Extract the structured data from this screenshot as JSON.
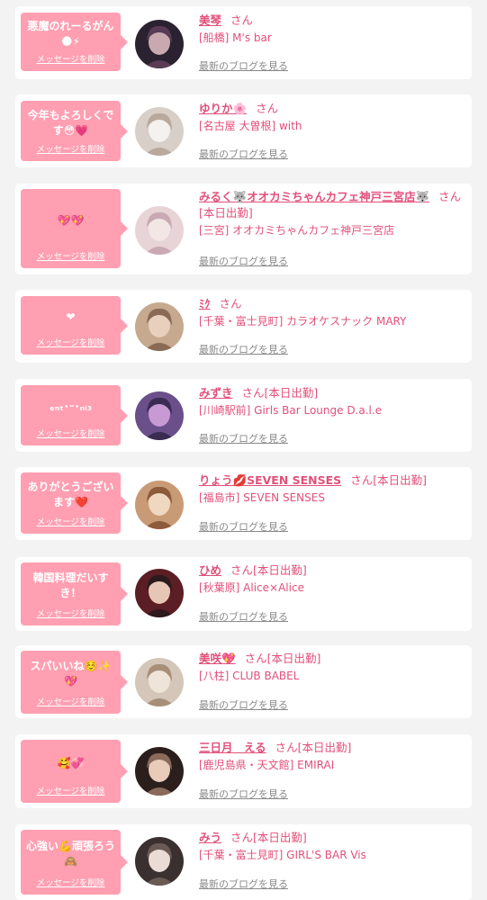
{
  "delete_label": "メッセージを削除",
  "blog_label": "最新のブログを見る",
  "colors": {
    "accent": "#e2507a",
    "bubble": "#ff9fb1",
    "background": "#f3f3f3"
  },
  "items": [
    {
      "message": "悪魔のれーるがん🌑⚡",
      "name": "美琴",
      "san": "さん",
      "shop": "[船橋] M's bar"
    },
    {
      "message": "今年もよろしくです😳💗",
      "name": "ゆりか🌸",
      "san": "さん",
      "shop": "[名古屋 大曽根] with"
    },
    {
      "message": "💖💖",
      "name": "みるく🐺オオカミちゃんカフェ神戸三宮店🐺",
      "san": "さん[本日出勤]",
      "shop": "[三宮] オオカミちゃんカフェ神戸三宮店"
    },
    {
      "message": "❤",
      "name": "ﾐｸ",
      "san": "さん",
      "shop": "[千葉・富士見町] カラオケスナック MARY"
    },
    {
      "message": "ₑₙₜ･ᵕ･ₙᵢ₃",
      "name": "みずき",
      "san": "さん[本日出勤]",
      "shop": "[川崎駅前] Girls Bar Lounge D.a.l.e"
    },
    {
      "message": "ありがとうございます❤️",
      "name": "りょう💋SEVEN SENSES",
      "san": "さん[本日出勤]",
      "shop": "[福島市] SEVEN SENSES"
    },
    {
      "message": "韓国料理だいすき！",
      "name": "ひめ",
      "san": "さん[本日出勤]",
      "shop": "[秋葉原] Alice×Alice"
    },
    {
      "message": "スパいいね☺️✨💖",
      "name": "美咲💖",
      "san": "さん[本日出勤]",
      "shop": "[八柱] CLUB BABEL"
    },
    {
      "message": "🥰💞",
      "name": "三日月　える",
      "san": "さん[本日出勤]",
      "shop": "[鹿児島県・天文館] EMIRAI"
    },
    {
      "message": "心強い💪頑張ろう🙈",
      "name": "みう",
      "san": "さん[本日出勤]",
      "shop": "[千葉・富士見町] GIRL'S BAR Vis"
    }
  ]
}
